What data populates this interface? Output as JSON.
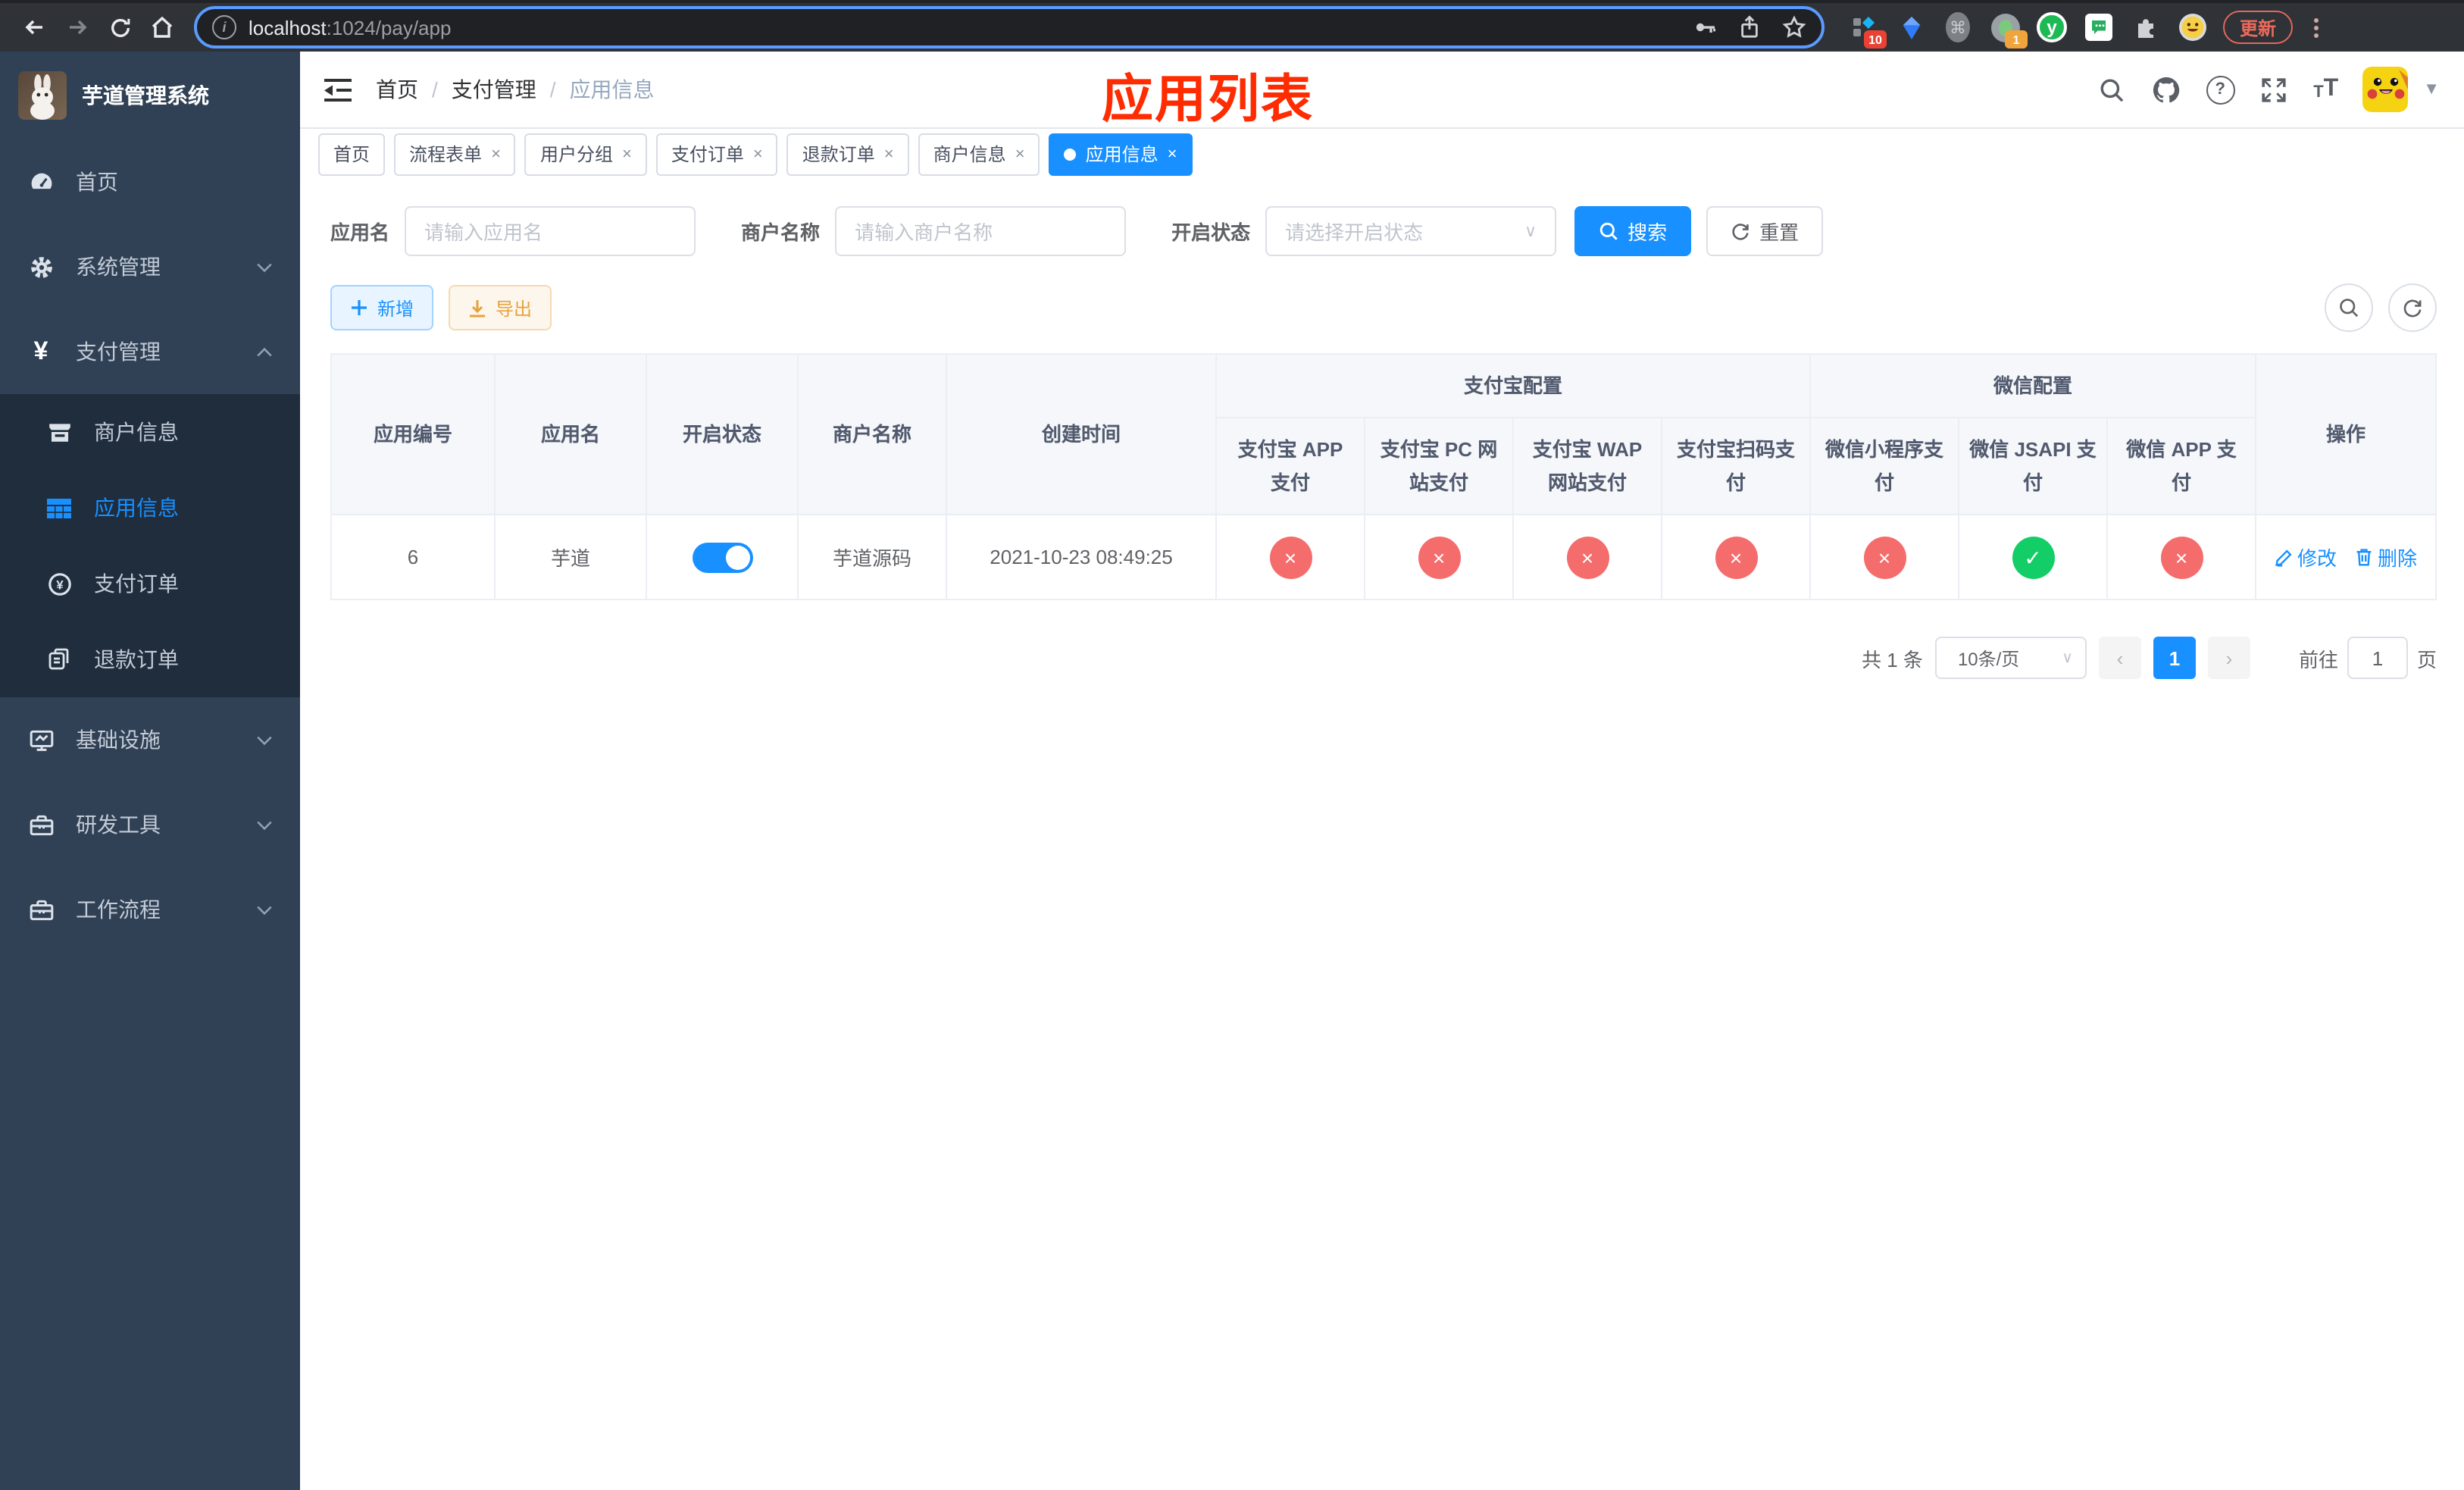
{
  "browser": {
    "url_host": "localhost",
    "url_path": ":1024/pay/app",
    "update_label": "更新",
    "ext_badge_blue": "10",
    "ext_badge_green": "1",
    "ext_y_label": "y"
  },
  "sidebar": {
    "title": "芋道管理系统",
    "items": [
      {
        "label": "首页"
      },
      {
        "label": "系统管理"
      },
      {
        "label": "支付管理"
      },
      {
        "label": "商户信息"
      },
      {
        "label": "应用信息"
      },
      {
        "label": "支付订单"
      },
      {
        "label": "退款订单"
      },
      {
        "label": "基础设施"
      },
      {
        "label": "研发工具"
      },
      {
        "label": "工作流程"
      }
    ]
  },
  "header": {
    "breadcrumb": [
      "首页",
      "支付管理",
      "应用信息"
    ],
    "annotation_title": "应用列表"
  },
  "tabs": [
    {
      "label": "首页",
      "closable": false,
      "active": false
    },
    {
      "label": "流程表单",
      "closable": true,
      "active": false
    },
    {
      "label": "用户分组",
      "closable": true,
      "active": false
    },
    {
      "label": "支付订单",
      "closable": true,
      "active": false
    },
    {
      "label": "退款订单",
      "closable": true,
      "active": false
    },
    {
      "label": "商户信息",
      "closable": true,
      "active": false
    },
    {
      "label": "应用信息",
      "closable": true,
      "active": true
    }
  ],
  "filters": {
    "app_name_label": "应用名",
    "app_name_placeholder": "请输入应用名",
    "merchant_label": "商户名称",
    "merchant_placeholder": "请输入商户名称",
    "status_label": "开启状态",
    "status_placeholder": "请选择开启状态",
    "search_label": "搜索",
    "reset_label": "重置"
  },
  "toolbar": {
    "add_label": "新增",
    "export_label": "导出"
  },
  "table": {
    "headers": {
      "app_id": "应用编号",
      "app_name": "应用名",
      "status": "开启状态",
      "merchant": "商户名称",
      "created": "创建时间",
      "alipay_group": "支付宝配置",
      "wechat_group": "微信配置",
      "alipay_app": "支付宝 APP 支付",
      "alipay_pc": "支付宝 PC 网站支付",
      "alipay_wap": "支付宝 WAP 网站支付",
      "alipay_qr": "支付宝扫码支付",
      "wx_mini": "微信小程序支付",
      "wx_jsapi": "微信 JSAPI 支付",
      "wx_app": "微信 APP 支付",
      "actions": "操作"
    },
    "row": {
      "id": "6",
      "name": "芋道",
      "enabled": true,
      "merchant": "芋道源码",
      "created": "2021-10-23 08:49:25",
      "configs": [
        false,
        false,
        false,
        false,
        false,
        true,
        false
      ]
    },
    "actions": {
      "edit": "修改",
      "delete": "删除"
    }
  },
  "pagination": {
    "total": "共 1 条",
    "page_size": "10条/页",
    "page": "1",
    "goto_prefix": "前往",
    "goto_value": "1",
    "goto_suffix": "页"
  },
  "colors": {
    "accent": "#1890ff",
    "success": "#13ce66",
    "danger": "#f56c6c",
    "warning": "#e6a23c",
    "annotation": "#fe2c00",
    "sidebar_bg": "#304156",
    "submenu_bg": "#1f2d3d"
  }
}
